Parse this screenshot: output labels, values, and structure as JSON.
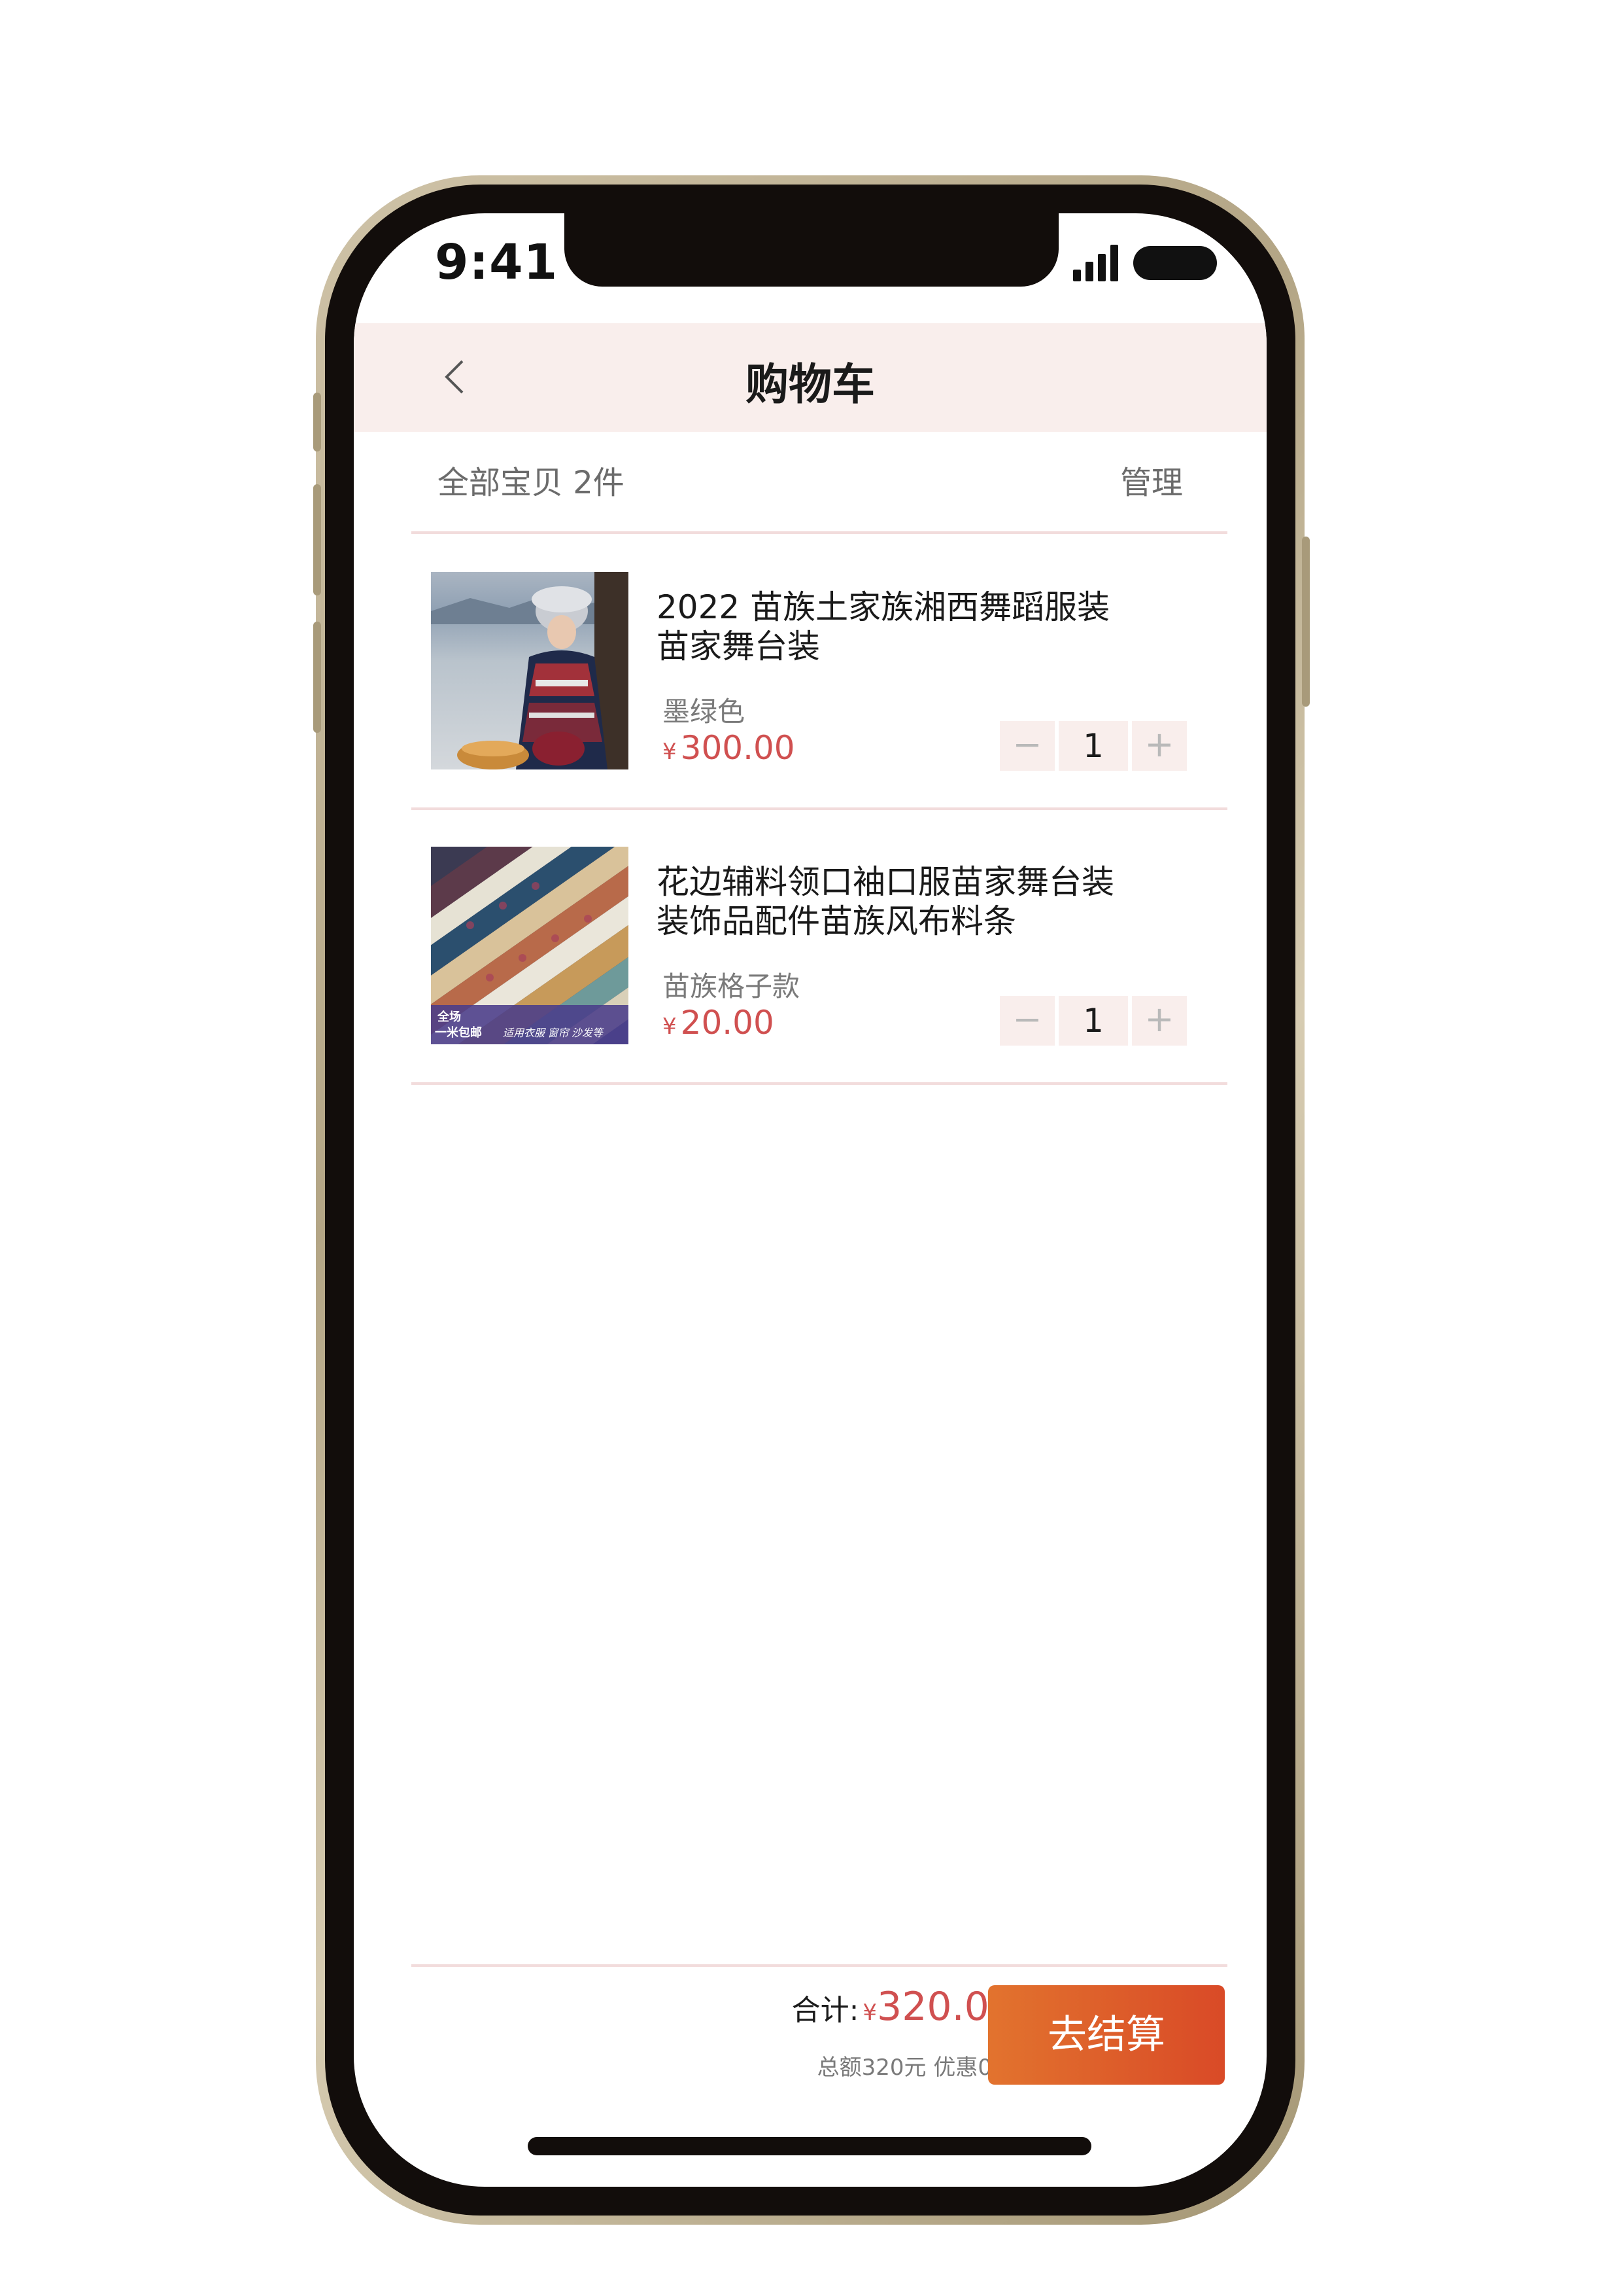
{
  "status_bar": {
    "time": "9:41"
  },
  "nav": {
    "title": "购物车",
    "back_icon": "chevron-left-icon"
  },
  "summary": {
    "label": "全部宝贝 2件",
    "manage": "管理"
  },
  "items": [
    {
      "title_line1": "2022 苗族土家族湘西舞蹈服装",
      "title_line2": "苗家舞台装",
      "variant": "墨绿色",
      "currency": "¥",
      "price": "300.00",
      "quantity": "1",
      "minus": "−",
      "plus": "+"
    },
    {
      "title_line1": "花边辅料领口袖口服苗家舞台装",
      "title_line2": "装饰品配件苗族风布料条",
      "variant": "苗族格子款",
      "currency": "¥",
      "price": "20.00",
      "quantity": "1",
      "minus": "−",
      "plus": "+",
      "badge_line1": "全场",
      "badge_line2": "一米包邮",
      "badge_note": "适用衣服 窗帘 沙发等"
    }
  ],
  "footer": {
    "total_label": "合计:",
    "currency": "¥",
    "total_value": "320.00",
    "sub_text": "总额320元 优惠0元",
    "checkout_label": "去结算"
  },
  "colors": {
    "accent_price": "#d05050",
    "nav_bg": "#f9eeec",
    "checkout_start": "#e2732e",
    "checkout_end": "#d94a27"
  }
}
